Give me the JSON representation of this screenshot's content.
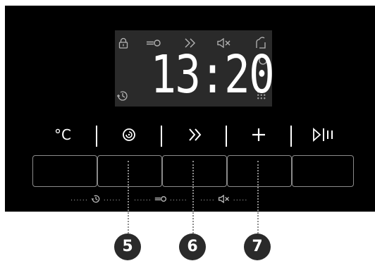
{
  "display": {
    "time": "13:20",
    "icons": [
      "lock-icon",
      "key-icon",
      "fast-forward-icon",
      "mute-icon",
      "steam-icon",
      "power-icon",
      "timer-icon",
      "grid-icon"
    ]
  },
  "buttons": [
    {
      "label": "°C",
      "icon": "temperature"
    },
    {
      "label": "⊚",
      "icon": "spiral-program"
    },
    {
      "label": "»",
      "icon": "fast-forward"
    },
    {
      "label": "+",
      "icon": "plus"
    },
    {
      "label": "▷|||",
      "icon": "play-pause"
    }
  ],
  "combos": [
    {
      "icon": "timer-icon"
    },
    {
      "icon": "key-icon"
    },
    {
      "icon": "mute-icon"
    }
  ],
  "callouts": [
    "5",
    "6",
    "7"
  ],
  "colors": {
    "panel": "#000000",
    "display": "#2a2a2a",
    "callout": "#2a2a2a",
    "text": "#ffffff"
  }
}
